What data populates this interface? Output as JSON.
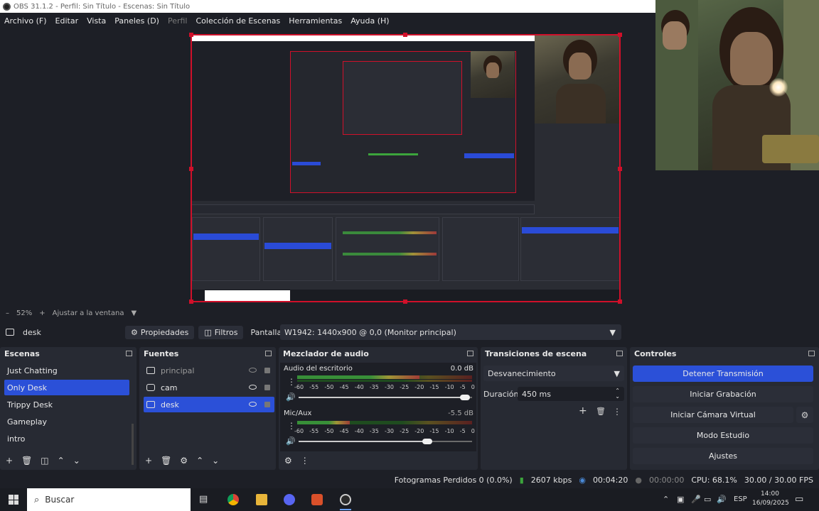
{
  "window": {
    "title": "OBS 31.1.2 - Perfil: Sin Título - Escenas: Sin Título"
  },
  "menu": {
    "items": [
      "Archivo (F)",
      "Editar",
      "Vista",
      "Paneles (D)",
      "Perfil",
      "Colección de Escenas",
      "Herramientas",
      "Ayuda (H)"
    ]
  },
  "preview": {
    "zoom_label": "52%",
    "fit_label": "Ajustar a la ventana"
  },
  "source_toolbar": {
    "scene_name": "desk",
    "properties_label": "Propiedades",
    "filters_label": "Filtros",
    "display_label": "Pantalla",
    "display_value": "W1942: 1440x900 @ 0,0 (Monitor principal)"
  },
  "scenes": {
    "title": "Escenas",
    "items": [
      "Just Chatting",
      "Only Desk",
      "Trippy Desk",
      "Gameplay",
      "intro"
    ],
    "selected_index": 1
  },
  "sources": {
    "title": "Fuentes",
    "items": [
      {
        "name": "principal",
        "icon": "monitor-icon",
        "visible": false
      },
      {
        "name": "cam",
        "icon": "camera-icon",
        "visible": true
      },
      {
        "name": "desk",
        "icon": "monitor-icon",
        "visible": true
      }
    ],
    "selected_index": 2
  },
  "mixer": {
    "title": "Mezclador de audio",
    "channels": [
      {
        "name": "Audio del escritorio",
        "db": "0.0 dB",
        "level": 0.7,
        "volume": 0.96
      },
      {
        "name": "Mic/Aux",
        "db": "-5.5 dB",
        "level": 0.3,
        "volume": 0.74
      }
    ],
    "ticks": [
      "-60",
      "-55",
      "-50",
      "-45",
      "-40",
      "-35",
      "-30",
      "-25",
      "-20",
      "-15",
      "-10",
      "-5",
      "0"
    ]
  },
  "transitions": {
    "title": "Transiciones de escena",
    "selected": "Desvanecimiento",
    "duration_label": "Duración",
    "duration_value": "450 ms"
  },
  "controls": {
    "title": "Controles",
    "stop_stream": "Detener Transmisión",
    "start_recording": "Iniciar Grabación",
    "start_virtual_cam": "Iniciar Cámara Virtual",
    "studio_mode": "Modo Estudio",
    "settings": "Ajustes"
  },
  "status": {
    "dropped_frames": "Fotogramas Perdidos 0 (0.0%)",
    "bitrate": "2607 kbps",
    "stream_time": "00:04:20",
    "record_time": "00:00:00",
    "cpu": "CPU: 68.1%",
    "fps": "30.00 / 30.00 FPS"
  },
  "taskbar": {
    "search_placeholder": "Buscar",
    "language": "ESP",
    "time": "14:00",
    "date": "16/09/2025"
  },
  "colors": {
    "accent": "#2b50d8",
    "selection": "#d0102a",
    "background": "#1d1f26",
    "dock": "#272a33"
  }
}
